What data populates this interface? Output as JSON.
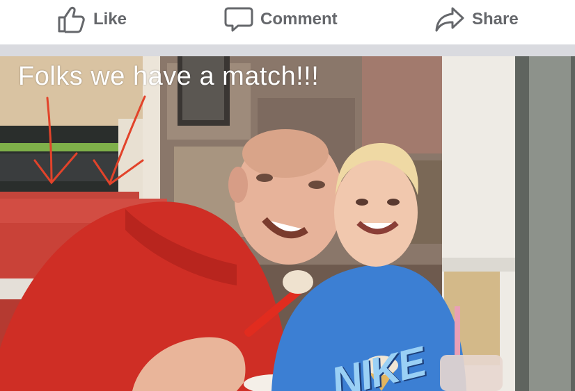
{
  "actions": {
    "like": {
      "label": "Like",
      "icon": "thumbs-up-icon"
    },
    "comment": {
      "label": "Comment",
      "icon": "comment-bubble-icon"
    },
    "share": {
      "label": "Share",
      "icon": "share-arrow-icon"
    }
  },
  "photo": {
    "caption_overlay": "Folks we have a match!!!",
    "shirt_text": "NIKE"
  },
  "colors": {
    "action_text": "#65676b",
    "divider": "#d9dadf",
    "annotation_arrows": "#e2432a"
  }
}
